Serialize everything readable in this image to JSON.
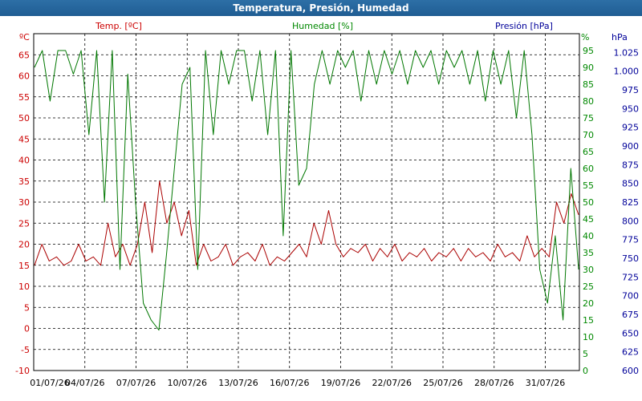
{
  "window": {
    "title": "Temperatura, Presión, Humedad"
  },
  "chart_data": {
    "type": "line",
    "title": "Temperatura, Presión, Humedad",
    "xlabel": "",
    "x_ticks": [
      "01/07/26",
      "04/07/26",
      "07/07/26",
      "10/07/26",
      "13/07/26",
      "16/07/26",
      "19/07/26",
      "22/07/26",
      "25/07/26",
      "28/07/26",
      "31/07/26"
    ],
    "x_range_days": [
      0,
      32
    ],
    "grid": true,
    "axes": {
      "temperature": {
        "label": "Temp. [ºC]",
        "unit": "ºC",
        "ylim": [
          -10,
          70
        ],
        "ticks": [
          -10,
          -5,
          0,
          5,
          10,
          15,
          20,
          25,
          30,
          35,
          40,
          45,
          50,
          55,
          60,
          65
        ],
        "color": "#cc0000"
      },
      "humidity": {
        "label": "Humedad [%]",
        "unit": "%",
        "ylim": [
          0,
          100
        ],
        "ticks": [
          0,
          5,
          10,
          15,
          20,
          25,
          30,
          35,
          40,
          45,
          50,
          55,
          60,
          65,
          70,
          75,
          80,
          85,
          90,
          95
        ],
        "color": "#008800"
      },
      "pressure": {
        "label": "Presión [hPa]",
        "unit": "hPa",
        "ylim": [
          600,
          1050
        ],
        "ticks": [
          "600",
          "625",
          "650",
          "675",
          "700",
          "725",
          "750",
          "775",
          "800",
          "825",
          "850",
          "875",
          "900",
          "925",
          "950",
          "975",
          "1.000",
          "1.025"
        ],
        "color": "#000099"
      }
    },
    "series": [
      {
        "name": "Temp. [ºC]",
        "axis": "temperature",
        "color": "#aa0000",
        "values": [
          15,
          20,
          16,
          17,
          15,
          16,
          20,
          16,
          17,
          15,
          25,
          17,
          20,
          15,
          20,
          30,
          18,
          35,
          25,
          30,
          22,
          28,
          15,
          20,
          16,
          17,
          20,
          15,
          17,
          18,
          16,
          20,
          15,
          17,
          16,
          18,
          20,
          17,
          25,
          20,
          28,
          20,
          17,
          19,
          18,
          20,
          16,
          19,
          17,
          20,
          16,
          18,
          17,
          19,
          16,
          18,
          17,
          19,
          16,
          19,
          17,
          18,
          16,
          20,
          17,
          18,
          16,
          22,
          17,
          19,
          17,
          30,
          25,
          32,
          27
        ]
      },
      {
        "name": "Humedad [%]",
        "axis": "humidity",
        "color": "#007700",
        "values": [
          90,
          95,
          80,
          95,
          95,
          88,
          95,
          70,
          95,
          50,
          95,
          30,
          88,
          50,
          20,
          15,
          12,
          35,
          60,
          85,
          90,
          30,
          95,
          70,
          95,
          85,
          95,
          95,
          80,
          95,
          70,
          95,
          40,
          95,
          55,
          60,
          85,
          95,
          85,
          95,
          90,
          95,
          80,
          95,
          85,
          95,
          88,
          95,
          85,
          95,
          90,
          95,
          85,
          95,
          90,
          95,
          85,
          95,
          80,
          95,
          85,
          95,
          75,
          95,
          70,
          30,
          20,
          40,
          15,
          60,
          30
        ]
      },
      {
        "name": "Presión [hPa]",
        "axis": "pressure",
        "color": "#000099",
        "values": []
      }
    ]
  }
}
